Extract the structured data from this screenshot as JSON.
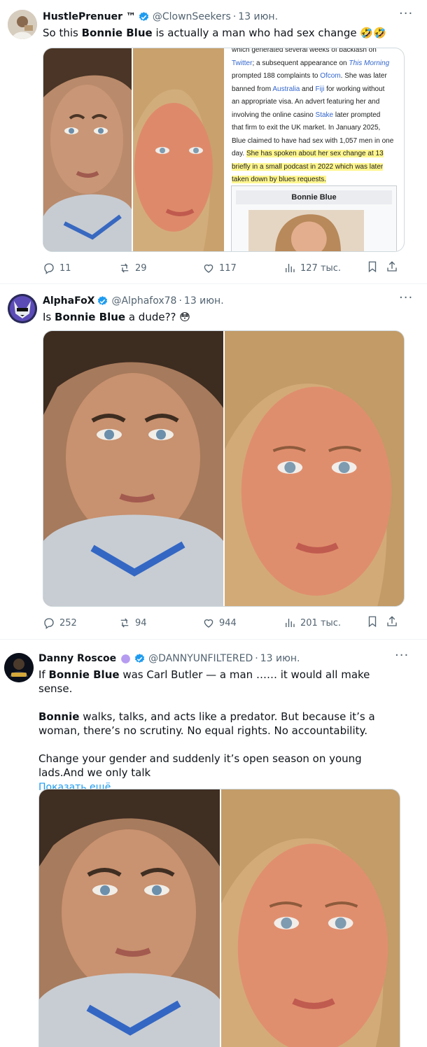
{
  "tweets": [
    {
      "display_name": "HustlePrenuer ™",
      "handle": "@ClownSeekers",
      "separator": "·",
      "time": "13 июн.",
      "text_before": "So this ",
      "text_bold": "Bonnie Blue",
      "text_after": " is actually a man who had sex change 🤣🤣",
      "replies": "11",
      "reposts": "29",
      "likes": "117",
      "views": "127 тыс.",
      "wiki_excerpt": {
        "line1": "which generated several weeks of backlash on",
        "line2_link": "Twitter",
        "line2_rest": "; a subsequent appearance on ",
        "line2_link2": "This Morning",
        "line3": "prompted 188 complaints to ",
        "line3_link": "Ofcom",
        "line3_rest": ". She was later",
        "line4": "banned from ",
        "line4_link": "Australia",
        "line4_mid": " and ",
        "line4_link2": "Fiji",
        "line4_rest": " for working without",
        "line5": "an appropriate visa. An advert featuring her and",
        "line6": "involving the online casino ",
        "line6_link": "Stake",
        "line6_rest": " later prompted",
        "line7": "that firm to exit the UK market. In January 2025,",
        "line8": "Blue claimed to have had sex with 1,057 men in one",
        "line9": "day. ",
        "line9_hl": "She has spoken about her sex change at 13",
        "line10_hl": "briefly in a small podcast in 2022 which was later",
        "line11_hl": "taken down by blues requests.",
        "infobox_title": "Bonnie Blue"
      }
    },
    {
      "display_name": "AlphaFoⅩ",
      "handle": "@Alphafox78",
      "separator": "·",
      "time": "13 июн.",
      "text_before": "Is ",
      "text_bold": "Bonnie Blue",
      "text_after": " a dude?? 😳",
      "replies": "252",
      "reposts": "94",
      "likes": "944",
      "views": "201 тыс."
    },
    {
      "display_name": "Danny Roscoe",
      "handle": "@DANNYUNFILTERED",
      "separator": "·",
      "time": "13 июн.",
      "p1_before": "If ",
      "p1_bold": "Bonnie Blue",
      "p1_after": " was Carl Butler — a man …… it would all make sense.",
      "p2_bold": "Bonnie",
      "p2_after": " walks, talks, and acts like a predator. But because it’s a woman, there’s no scrutiny. No equal rights. No accountability.",
      "p3": "Change your gender and suddenly it’s open season on young lads.And we only talk",
      "show_more": "Показать ещё"
    }
  ],
  "colors": {
    "accent": "#1d9bf0",
    "secondary_text": "#536471",
    "verified_blue": "#1d9bf0",
    "highlight": "#fff68f"
  },
  "icons": [
    "more-icon",
    "reply-icon",
    "repost-icon",
    "like-icon",
    "views-icon",
    "bookmark-icon",
    "share-icon",
    "verified-badge-icon",
    "purple-circle-icon"
  ]
}
